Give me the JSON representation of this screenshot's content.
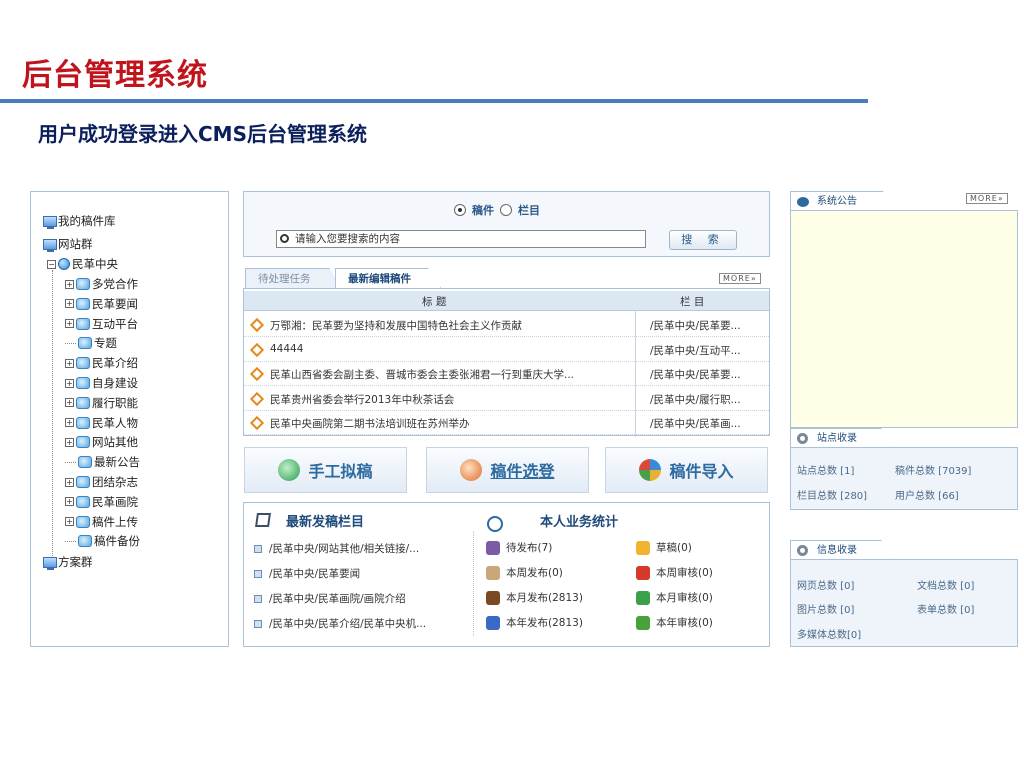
{
  "slide": {
    "title": "后台管理系统",
    "subtitle": "用户成功登录进入CMS后台管理系统"
  },
  "tree": {
    "my_library": "我的稿件库",
    "site_group": "网站群",
    "root": "民革中央",
    "children": [
      "多党合作",
      "民革要闻",
      "互动平台",
      "专题",
      "民革介绍",
      "自身建设",
      "履行职能",
      "民革人物",
      "网站其他",
      "最新公告",
      "团结杂志",
      "民革画院",
      "稿件上传",
      "稿件备份"
    ],
    "plan_group": "方案群"
  },
  "search": {
    "radio_doc": "稿件",
    "radio_column": "栏目",
    "selected": "稿件",
    "placeholder": "请输入您要搜索的内容",
    "button": "搜 索"
  },
  "tasks": {
    "tab_pending": "待处理任务",
    "tab_latest": "最新编辑稿件",
    "more": "MORE»",
    "col_title": "标   题",
    "col_column": "栏   目",
    "rows": [
      {
        "title": "万鄂湘：民革要为坚持和发展中国特色社会主义作贡献",
        "column": "/民革中央/民革要..."
      },
      {
        "title": "44444",
        "column": "/民革中央/互动平..."
      },
      {
        "title": "民革山西省委会副主委、晋城市委会主委张湘君一行到重庆大学...",
        "column": "/民革中央/民革要..."
      },
      {
        "title": "民革贵州省委会举行2013年中秋茶话会",
        "column": "/民革中央/履行职..."
      },
      {
        "title": "民革中央画院第二期书法培训班在苏州举办",
        "column": "/民革中央/民革画..."
      }
    ]
  },
  "actions": {
    "manual": "手工拟稿",
    "select": "稿件选登",
    "import": "稿件导入"
  },
  "latest_columns": {
    "title": "最新发稿栏目",
    "items": [
      "/民革中央/网站其他/相关链接/...",
      "/民革中央/民革要闻",
      "/民革中央/民革画院/画院介绍",
      "/民革中央/民革介绍/民革中央机..."
    ]
  },
  "my_stats": {
    "title": "本人业务统计",
    "items": [
      {
        "label": "待发布(7)",
        "icon": "box-icon",
        "color": "#7b5aa6"
      },
      {
        "label": "草稿(0)",
        "icon": "draft-icon",
        "color": "#f0b430"
      },
      {
        "label": "本周发布(0)",
        "icon": "stamp-icon",
        "color": "#c8a878"
      },
      {
        "label": "本周审核(0)",
        "icon": "seal-icon",
        "color": "#d43a2a"
      },
      {
        "label": "本月发布(2813)",
        "icon": "book-icon",
        "color": "#7a4a22"
      },
      {
        "label": "本月审核(0)",
        "icon": "sheet-icon",
        "color": "#3aa04a"
      },
      {
        "label": "本年发布(2813)",
        "icon": "stack-icon",
        "color": "#3a6ac8"
      },
      {
        "label": "本年审核(0)",
        "icon": "leaf-icon",
        "color": "#4aa03a"
      }
    ]
  },
  "notice": {
    "tab": "系统公告",
    "more": "MORE»"
  },
  "site_stats": {
    "tab": "站点收录",
    "site_total": "站点总数 [1]",
    "doc_total": "稿件总数 [7039]",
    "column_total": "栏目总数 [280]",
    "user_total": "用户总数 [66]"
  },
  "info_stats": {
    "tab": "信息收录",
    "page_total": "网页总数 [0]",
    "file_total": "文档总数 [0]",
    "image_total": "图片总数 [0]",
    "form_total": "表单总数 [0]",
    "media_total": "多媒体总数[0]"
  }
}
